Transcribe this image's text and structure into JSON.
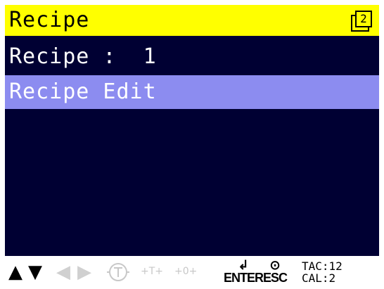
{
  "titlebar": {
    "title": "Recipe",
    "page_indicator": "2"
  },
  "rows": [
    {
      "text": "Recipe :  1",
      "selected": false
    },
    {
      "text": "Recipe Edit",
      "selected": true
    }
  ],
  "footer": {
    "keys": [
      {
        "name": "up-arrow-icon",
        "glyph": "▲",
        "enabled": true
      },
      {
        "name": "down-arrow-icon",
        "glyph": "▼",
        "enabled": true
      },
      {
        "name": "left-arrow-icon",
        "glyph": "◀",
        "enabled": false
      },
      {
        "name": "right-arrow-icon",
        "glyph": "▶",
        "enabled": false
      },
      {
        "name": "tare-icon",
        "glyph": "⊤",
        "enabled": false
      },
      {
        "name": "preset-tare-icon",
        "glyph": "+T+",
        "enabled": false
      },
      {
        "name": "zero-icon",
        "glyph": "+0+",
        "enabled": false
      }
    ],
    "enter_label": "ENTER",
    "esc_label": "ESC",
    "tac": "TAC:12",
    "cal": "CAL:2"
  },
  "colors": {
    "title_bg": "#ffff00",
    "screen_bg": "#000033",
    "selection": "#8c8cf0",
    "text": "#ffffff"
  }
}
